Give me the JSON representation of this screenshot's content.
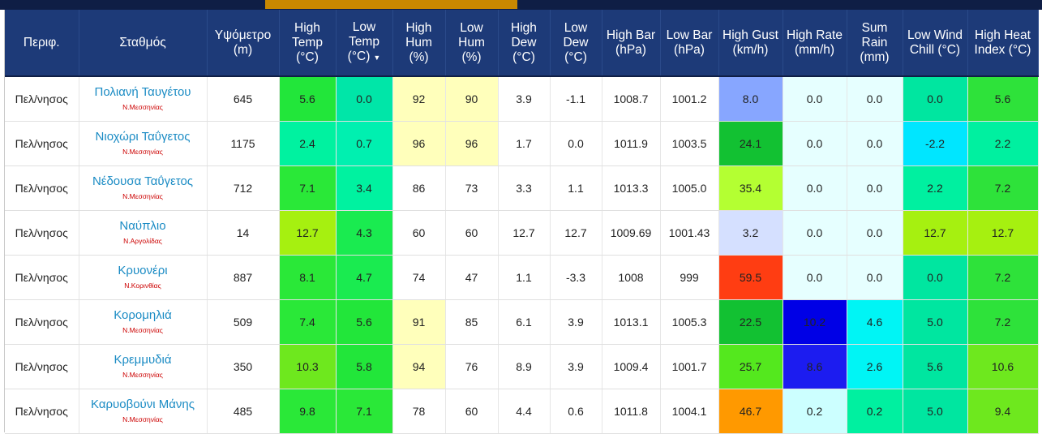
{
  "headers": [
    {
      "key": "region",
      "label": "Περιφ."
    },
    {
      "key": "station",
      "label": "Σταθμός"
    },
    {
      "key": "alt",
      "label": "Υψόμετρο (m)"
    },
    {
      "key": "hitemp",
      "label": "High Temp (°C)"
    },
    {
      "key": "lotemp",
      "label": "Low Temp (°C)",
      "sorted": true
    },
    {
      "key": "hihum",
      "label": "High Hum (%)"
    },
    {
      "key": "lohum",
      "label": "Low Hum (%)"
    },
    {
      "key": "hidew",
      "label": "High Dew (°C)"
    },
    {
      "key": "lodew",
      "label": "Low Dew (°C)"
    },
    {
      "key": "hibar",
      "label": "High Bar (hPa)"
    },
    {
      "key": "lobar",
      "label": "Low Bar (hPa)"
    },
    {
      "key": "higust",
      "label": "High Gust (km/h)"
    },
    {
      "key": "hirate",
      "label": "High Rate (mm/h)"
    },
    {
      "key": "sumrain",
      "label": "Sum Rain (mm)"
    },
    {
      "key": "lowind",
      "label": "Low Wind Chill (°C)"
    },
    {
      "key": "hiheat",
      "label": "High Heat Index (°C)"
    }
  ],
  "sort_indicator": "▼",
  "rows": [
    {
      "region": "Πελ/νησος",
      "station": "Πολιανή Ταυγέτου",
      "pref": "Ν.Μεσσηνίας",
      "alt": "645",
      "cells": [
        [
          "5.6",
          "#22e63a"
        ],
        [
          "0.0",
          "#00e6a8"
        ],
        [
          "92",
          "#ffffbb"
        ],
        [
          "90",
          "#ffffbb"
        ],
        [
          "3.9",
          "#ffffff"
        ],
        [
          "-1.1",
          "#ffffff"
        ],
        [
          "1008.7",
          "#ffffff"
        ],
        [
          "1001.2",
          "#ffffff"
        ],
        [
          "8.0",
          "#87a6ff"
        ],
        [
          "0.0",
          "#e6ffff"
        ],
        [
          "0.0",
          "#e6ffff"
        ],
        [
          "0.0",
          "#00e6a0"
        ],
        [
          "5.6",
          "#2ee23a"
        ]
      ]
    },
    {
      "region": "Πελ/νησος",
      "station": "Νιοχώρι Ταΰγετος",
      "pref": "Ν.Μεσσηνίας",
      "alt": "1175",
      "cells": [
        [
          "2.4",
          "#00f2a0"
        ],
        [
          "0.7",
          "#00f0b0"
        ],
        [
          "96",
          "#ffffbb"
        ],
        [
          "96",
          "#ffffbb"
        ],
        [
          "1.7",
          "#ffffff"
        ],
        [
          "0.0",
          "#ffffff"
        ],
        [
          "1011.9",
          "#ffffff"
        ],
        [
          "1003.5",
          "#ffffff"
        ],
        [
          "24.1",
          "#12c132"
        ],
        [
          "0.0",
          "#e6ffff"
        ],
        [
          "0.0",
          "#e6ffff"
        ],
        [
          "-2.2",
          "#00e6ff"
        ],
        [
          "2.2",
          "#00f0a0"
        ]
      ]
    },
    {
      "region": "Πελ/νησος",
      "station": "Νέδουσα Ταΰγετος",
      "pref": "Ν.Μεσσηνίας",
      "alt": "712",
      "cells": [
        [
          "7.1",
          "#2ae838"
        ],
        [
          "3.4",
          "#00f2a0"
        ],
        [
          "86",
          "#ffffff"
        ],
        [
          "73",
          "#ffffff"
        ],
        [
          "3.3",
          "#ffffff"
        ],
        [
          "1.1",
          "#ffffff"
        ],
        [
          "1013.3",
          "#ffffff"
        ],
        [
          "1005.0",
          "#ffffff"
        ],
        [
          "35.4",
          "#b4ff32"
        ],
        [
          "0.0",
          "#e6ffff"
        ],
        [
          "0.0",
          "#e6ffff"
        ],
        [
          "2.2",
          "#00f0a0"
        ],
        [
          "7.2",
          "#2ee23a"
        ]
      ]
    },
    {
      "region": "Πελ/νησος",
      "station": "Ναύπλιο",
      "pref": "Ν.Αργολίδας",
      "alt": "14",
      "cells": [
        [
          "12.7",
          "#a6f010"
        ],
        [
          "4.3",
          "#1aeb50"
        ],
        [
          "60",
          "#ffffff"
        ],
        [
          "60",
          "#ffffff"
        ],
        [
          "12.7",
          "#ffffff"
        ],
        [
          "12.7",
          "#ffffff"
        ],
        [
          "1009.69",
          "#ffffff"
        ],
        [
          "1001.43",
          "#ffffff"
        ],
        [
          "3.2",
          "#d5e0ff"
        ],
        [
          "0.0",
          "#e6ffff"
        ],
        [
          "0.0",
          "#e6ffff"
        ],
        [
          "12.7",
          "#a6f010"
        ],
        [
          "12.7",
          "#a6f010"
        ]
      ]
    },
    {
      "region": "Πελ/νησος",
      "station": "Κρυονέρι",
      "pref": "Ν.Κορινθίας",
      "alt": "887",
      "cells": [
        [
          "8.1",
          "#2ae838"
        ],
        [
          "4.7",
          "#1aeb50"
        ],
        [
          "74",
          "#ffffff"
        ],
        [
          "47",
          "#ffffff"
        ],
        [
          "1.1",
          "#ffffff"
        ],
        [
          "-3.3",
          "#ffffff"
        ],
        [
          "1008",
          "#ffffff"
        ],
        [
          "999",
          "#ffffff"
        ],
        [
          "59.5",
          "#ff3d12"
        ],
        [
          "0.0",
          "#e6ffff"
        ],
        [
          "0.0",
          "#e6ffff"
        ],
        [
          "0.0",
          "#00e6a0"
        ],
        [
          "7.2",
          "#2ee23a"
        ]
      ]
    },
    {
      "region": "Πελ/νησος",
      "station": "Κορομηλιά",
      "pref": "Ν.Μεσσηνίας",
      "alt": "509",
      "cells": [
        [
          "7.4",
          "#2ae838"
        ],
        [
          "5.6",
          "#22e63a"
        ],
        [
          "91",
          "#ffffbb"
        ],
        [
          "85",
          "#ffffff"
        ],
        [
          "6.1",
          "#ffffff"
        ],
        [
          "3.9",
          "#ffffff"
        ],
        [
          "1013.1",
          "#ffffff"
        ],
        [
          "1005.3",
          "#ffffff"
        ],
        [
          "22.5",
          "#12c132"
        ],
        [
          "10.2",
          "#0000e6"
        ],
        [
          "4.6",
          "#00f5f5"
        ],
        [
          "5.0",
          "#00e6a0"
        ],
        [
          "7.2",
          "#2ee23a"
        ]
      ]
    },
    {
      "region": "Πελ/νησος",
      "station": "Κρεμμυδιά",
      "pref": "Ν.Μεσσηνίας",
      "alt": "350",
      "cells": [
        [
          "10.3",
          "#6ee81e"
        ],
        [
          "5.8",
          "#22e63a"
        ],
        [
          "94",
          "#ffffbb"
        ],
        [
          "76",
          "#ffffff"
        ],
        [
          "8.9",
          "#ffffff"
        ],
        [
          "3.9",
          "#ffffff"
        ],
        [
          "1009.4",
          "#ffffff"
        ],
        [
          "1001.7",
          "#ffffff"
        ],
        [
          "25.7",
          "#54e81e"
        ],
        [
          "8.6",
          "#1c1cf0"
        ],
        [
          "2.6",
          "#00f5f5"
        ],
        [
          "5.6",
          "#00e6a0"
        ],
        [
          "10.6",
          "#6ee81e"
        ]
      ]
    },
    {
      "region": "Πελ/νησος",
      "station": "Καρυοβούνι Μάνης",
      "pref": "Ν.Μεσσηνίας",
      "alt": "485",
      "cells": [
        [
          "9.8",
          "#2ae838"
        ],
        [
          "7.1",
          "#2ae838"
        ],
        [
          "78",
          "#ffffff"
        ],
        [
          "60",
          "#ffffff"
        ],
        [
          "4.4",
          "#ffffff"
        ],
        [
          "0.6",
          "#ffffff"
        ],
        [
          "1011.8",
          "#ffffff"
        ],
        [
          "1004.1",
          "#ffffff"
        ],
        [
          "46.7",
          "#ff9900"
        ],
        [
          "0.2",
          "#ccffff"
        ],
        [
          "0.2",
          "#00f0a0"
        ],
        [
          "5.0",
          "#00e6a0"
        ],
        [
          "9.4",
          "#6ee81e"
        ]
      ]
    }
  ]
}
